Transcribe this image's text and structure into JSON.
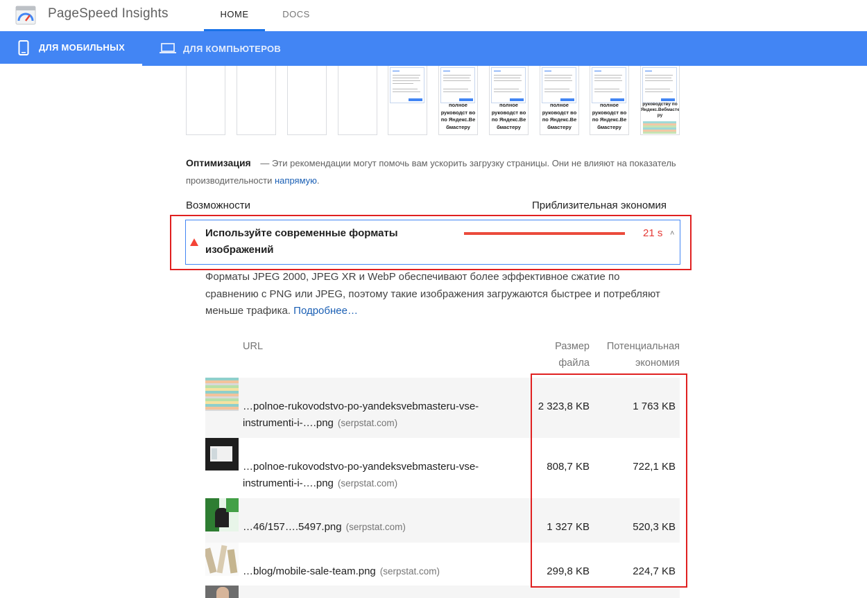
{
  "header": {
    "app_title": "PageSpeed Insights",
    "tabs": [
      {
        "label": "HOME",
        "active": true
      },
      {
        "label": "DOCS",
        "active": false
      }
    ]
  },
  "device_tabs": [
    {
      "label": "ДЛЯ МОБИЛЬНЫХ",
      "icon": "smartphone-icon",
      "active": true
    },
    {
      "label": "ДЛЯ КОМПЬЮТЕРОВ",
      "icon": "laptop-icon",
      "active": false
    }
  ],
  "filmstrip": {
    "frame_text": [
      "полное руководст во по Яндекс.Ве бмастеру",
      "полное руководст во по Яндекс.Ве бмастеру",
      "полное руководст во по Яндекс.Ве бмастеру",
      "полное руководст во по Яндекс.Ве бмастеру",
      "руководству по Яндекс.Вебмасте ру"
    ]
  },
  "optimization": {
    "title": "Оптимизация",
    "text": "— Эти рекомендации могут помочь вам ускорить загрузку страницы. Они не влияют на показатель производительности",
    "link": "напрямую",
    "end": "."
  },
  "columns": {
    "left": "Возможности",
    "right": "Приблизительная экономия"
  },
  "audit": {
    "title": "Используйте современные форматы изображений",
    "savings": "21 s",
    "description": "Форматы JPEG 2000, JPEG XR и WebP обеспечивают более эффективное сжатие по сравнению с PNG или JPEG, поэтому такие изображения загружаются быстрее и потребляют меньше трафика.",
    "learn_more": "Подробнее…"
  },
  "table": {
    "headers": {
      "url": "URL",
      "size": "Размер файла",
      "savings": "Потенциальная экономия"
    },
    "rows": [
      {
        "url_line1": "…polnoe-rukovodstvo-po-yandeksvebmasteru-vse-",
        "url_line2": "instrumenti-i-….png",
        "host": "(serpstat.com)",
        "size": "2 323,8 KB",
        "savings": "1 763 KB"
      },
      {
        "url_line1": "…polnoe-rukovodstvo-po-yandeksvebmasteru-vse-",
        "url_line2": "instrumenti-i-….png",
        "host": "(serpstat.com)",
        "size": "808,7 KB",
        "savings": "722,1 KB"
      },
      {
        "url_line1": "…46/157….5497.png",
        "host": "(serpstat.com)",
        "size": "1 327 KB",
        "savings": "520,3 KB"
      },
      {
        "url_line1": "…blog/mobile-sale-team.png",
        "host": "(serpstat.com)",
        "size": "299,8 KB",
        "savings": "224,7 KB"
      }
    ]
  },
  "colors": {
    "accent": "#4285f4",
    "warning": "#e53935",
    "highlight": "#e02020"
  }
}
